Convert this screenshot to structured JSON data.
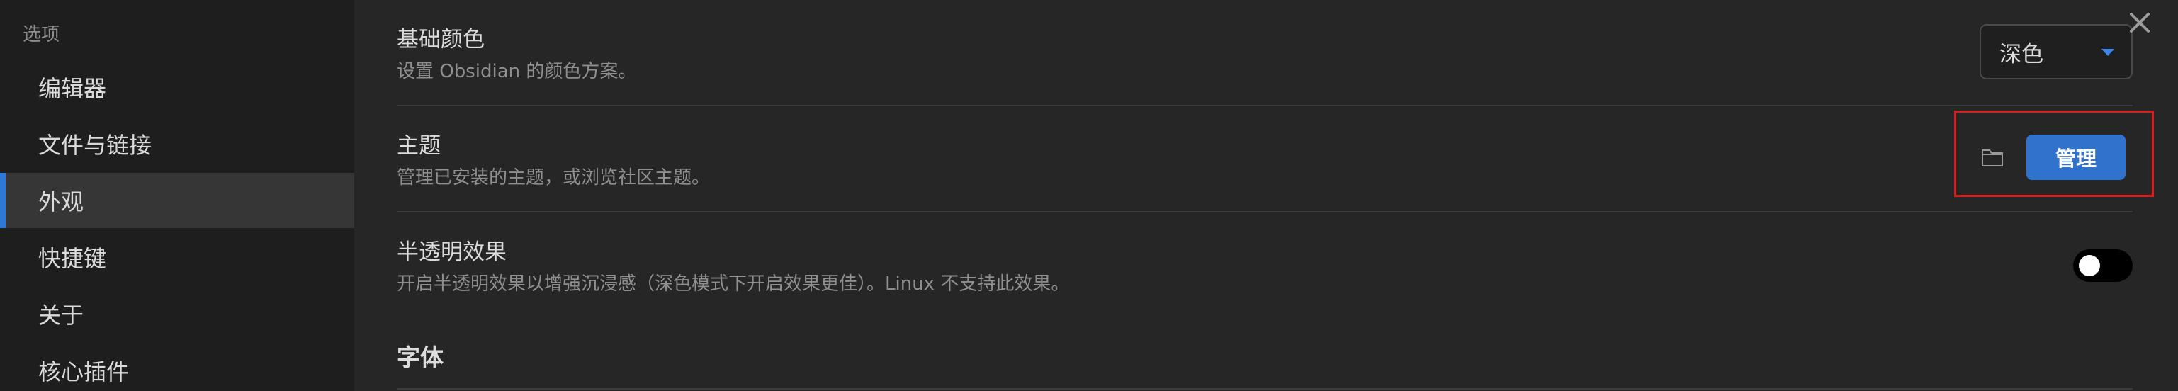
{
  "sidebar": {
    "heading": "选项",
    "items": [
      {
        "label": "编辑器"
      },
      {
        "label": "文件与链接"
      },
      {
        "label": "外观",
        "active": true
      },
      {
        "label": "快捷键"
      },
      {
        "label": "关于"
      },
      {
        "label": "核心插件"
      }
    ]
  },
  "settings": {
    "base_color": {
      "title": "基础颜色",
      "description": "设置 Obsidian 的颜色方案。",
      "selected_value": "深色"
    },
    "theme": {
      "title": "主题",
      "description": "管理已安装的主题，或浏览社区主题。",
      "manage_label": "管理"
    },
    "translucency": {
      "title": "半透明效果",
      "description": "开启半透明效果以增强沉浸感（深色模式下开启效果更佳）。Linux 不支持此效果。",
      "enabled": false
    }
  },
  "font_section": {
    "heading": "字体"
  },
  "colors": {
    "accent": "#2f73cc",
    "highlight_box": "#d51f1f",
    "background": "#262626",
    "sidebar": "#1e1e1e"
  },
  "icons": {
    "close": "close-icon",
    "folder": "folder-icon",
    "caret": "chevron-down-icon"
  }
}
